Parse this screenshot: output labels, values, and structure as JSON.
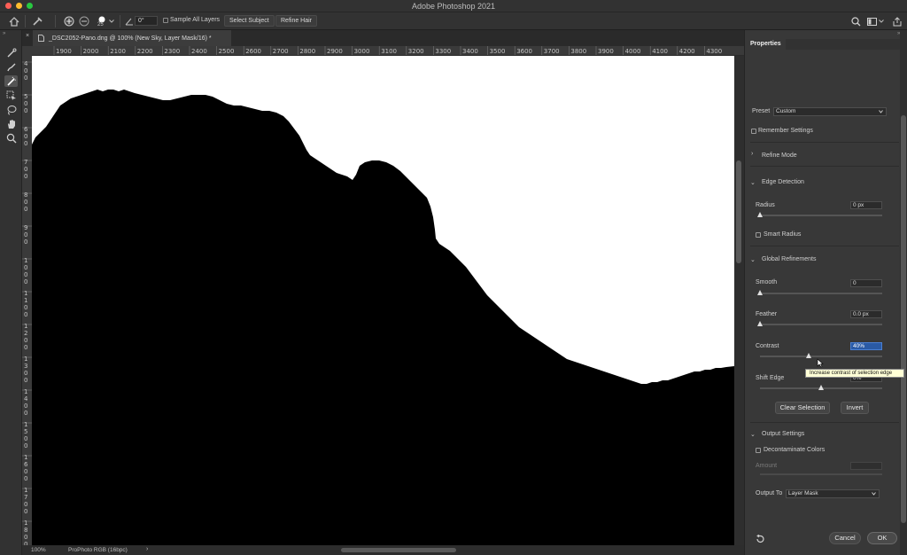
{
  "app": {
    "title": "Adobe Photoshop 2021"
  },
  "options_bar": {
    "brush_size": "25",
    "angle": "0°",
    "sample_all_layers": "Sample All Layers",
    "select_subject": "Select Subject",
    "refine_hair": "Refine Hair"
  },
  "document": {
    "tab_title": "_DSC2052-Pano.dng @ 100% (New Sky, Layer Mask/16) *"
  },
  "ruler": {
    "h_ticks": [
      "1900",
      "2000",
      "2100",
      "2200",
      "2300",
      "2400",
      "2500",
      "2600",
      "2700",
      "2800",
      "2900",
      "3000",
      "3100",
      "3200",
      "3300",
      "3400",
      "3500",
      "3600",
      "3700",
      "3800",
      "3900",
      "4000",
      "4100",
      "4200",
      "4300"
    ],
    "v_ticks": [
      "4",
      "5",
      "6",
      "7",
      "8",
      "9",
      "10",
      "11",
      "12",
      "13",
      "14",
      "15",
      "16",
      "17",
      "18"
    ]
  },
  "status_bar": {
    "zoom": "100%",
    "profile": "ProPhoto RGB (16bpc)"
  },
  "properties": {
    "tab": "Properties",
    "preset_label": "Preset",
    "preset_value": "Custom",
    "remember_settings": "Remember Settings",
    "refine_mode": "Refine Mode",
    "edge_detection": "Edge Detection",
    "radius_label": "Radius",
    "radius_value": "0 px",
    "smart_radius": "Smart Radius",
    "global_refinements": "Global Refinements",
    "smooth_label": "Smooth",
    "smooth_value": "0",
    "feather_label": "Feather",
    "feather_value": "0.0 px",
    "contrast_label": "Contrast",
    "contrast_value": "40%",
    "shift_edge_label": "Shift Edge",
    "shift_edge_value": "0%",
    "clear_selection": "Clear Selection",
    "invert": "Invert",
    "output_settings": "Output Settings",
    "decontaminate_colors": "Decontaminate Colors",
    "amount_label": "Amount",
    "output_to_label": "Output To",
    "output_to_value": "Layer Mask",
    "cancel": "Cancel",
    "ok": "OK",
    "tooltip": "Increase contrast of selection edge"
  },
  "sliders": {
    "radius": 0,
    "smooth": 0,
    "feather": 0,
    "contrast": 0.4,
    "shift_edge": 0.5
  },
  "colors": {
    "selection_highlight": "#2a5aa5",
    "tooltip_bg": "#ffffd6",
    "close": "#fe5f57",
    "minimize": "#febc2e",
    "maximize": "#28c840"
  }
}
